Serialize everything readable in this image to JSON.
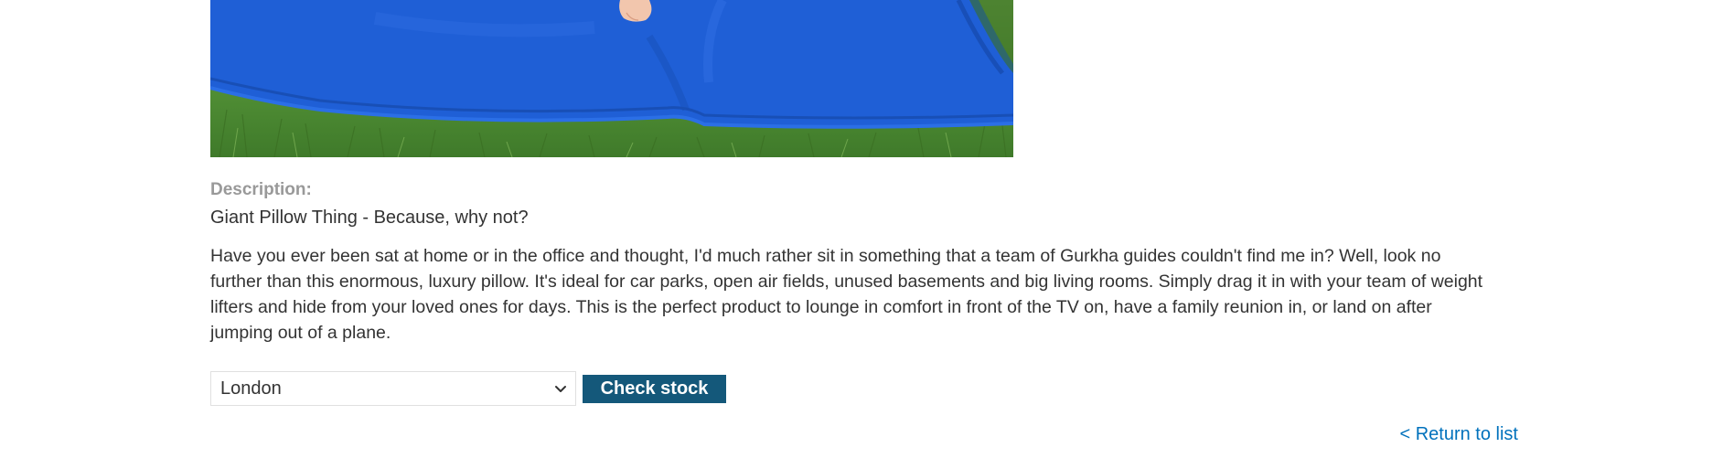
{
  "product": {
    "image_alt": "Blue giant pillow on grass",
    "description_label": "Description:",
    "title": "Giant Pillow Thing - Because, why not?",
    "body": "Have you ever been sat at home or in the office and thought, I'd much rather sit in something that a team of Gurkha guides couldn't find me in? Well, look no further than this enormous, luxury pillow. It's ideal for car parks, open air fields, unused basements and big living rooms. Simply drag it in with your team of weight lifters and hide from your loved ones for days. This is the perfect product to lounge in comfort in front of the TV on, have a family reunion in, or land on after jumping out of a plane."
  },
  "stock_check": {
    "selected_store": "London",
    "button_label": "Check stock"
  },
  "nav": {
    "return_label": "< Return to list"
  },
  "colors": {
    "button_bg": "#14587a",
    "link": "#0071bc",
    "label_gray": "#999999",
    "pillow_blue": "#1f5fd6"
  },
  "icons": {
    "select_chevron": "chevron-down-icon"
  }
}
